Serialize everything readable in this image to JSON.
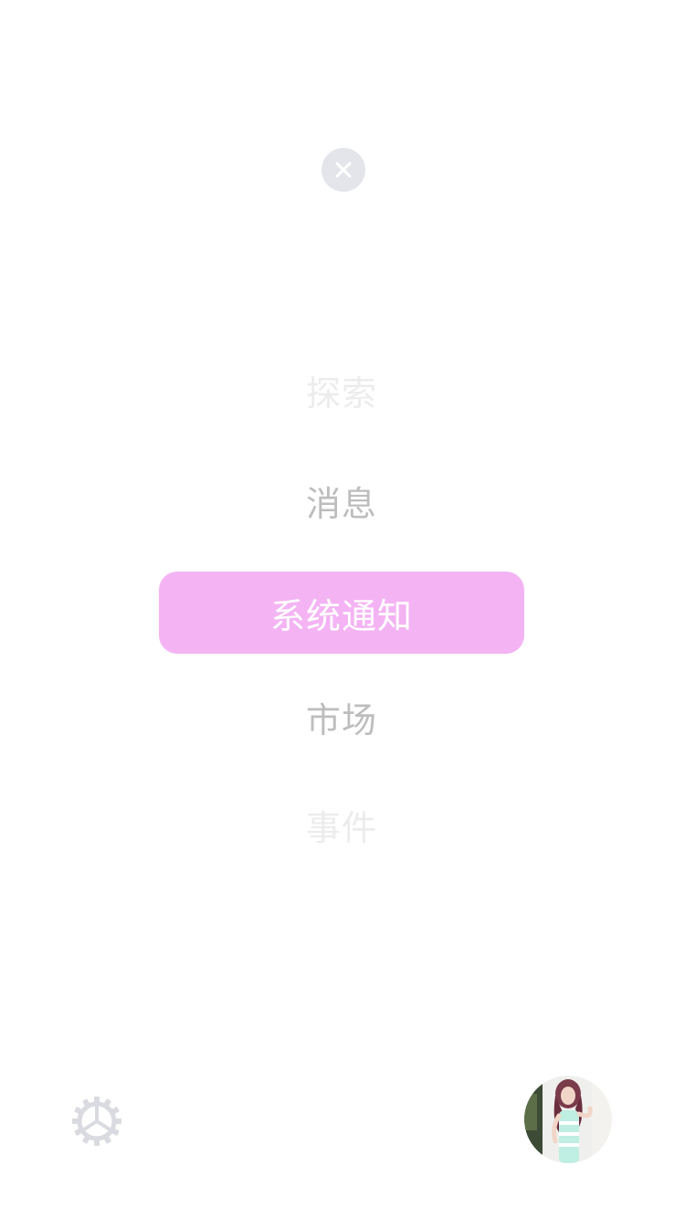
{
  "close": {
    "icon": "close-icon"
  },
  "menu": {
    "items": [
      {
        "label": "探索",
        "state": "faint"
      },
      {
        "label": "消息",
        "state": "dim"
      },
      {
        "label": "系统通知",
        "state": "active"
      },
      {
        "label": "市场",
        "state": "dim"
      },
      {
        "label": "事件",
        "state": "faint"
      }
    ],
    "active_color": "#f4b4f4"
  },
  "footer": {
    "settings_icon": "gear-icon",
    "avatar": "user-avatar"
  }
}
